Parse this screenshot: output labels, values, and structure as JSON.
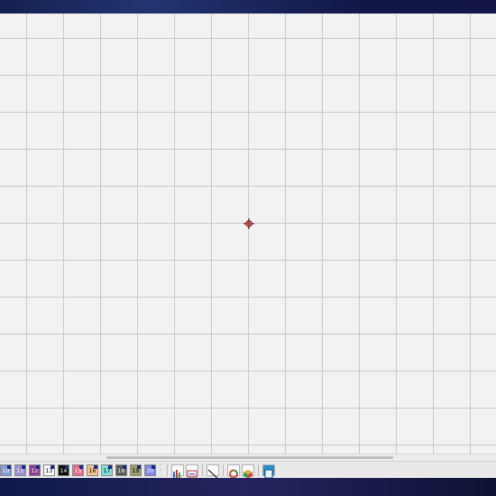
{
  "desktop": {
    "wallpaper_colors": [
      "#0d1640",
      "#1a1550",
      "#0a0f2c"
    ]
  },
  "canvas": {
    "background": "#f2f2f2",
    "grid_color": "#c9c9c9",
    "marker_color": "#8b1a1a"
  },
  "palette": [
    {
      "num": "10",
      "color": "#7f9bd6",
      "text": "#ffffff"
    },
    {
      "num": "11",
      "color": "#9d8fcf",
      "text": "#ffffff"
    },
    {
      "num": "12",
      "color": "#8a3e8f",
      "text": "#ffffff"
    },
    {
      "num": "13",
      "color": "#f7f7f7",
      "text": "#000000"
    },
    {
      "num": "14",
      "color": "#111111",
      "text": "#ffffff"
    },
    {
      "num": "15",
      "color": "#e76a8a",
      "text": "#ffffff"
    },
    {
      "num": "16",
      "color": "#f3c48a",
      "text": "#000000"
    },
    {
      "num": "17",
      "color": "#7fe0d6",
      "text": "#000000"
    },
    {
      "num": "18",
      "color": "#5a5a5a",
      "text": "#ffffff"
    },
    {
      "num": "19",
      "color": "#9b9b6a",
      "text": "#000000"
    },
    {
      "num": "20",
      "color": "#7f87e6",
      "text": "#ffffff"
    }
  ],
  "spinner": {
    "up": "˄",
    "down": "˅"
  },
  "tools": [
    {
      "name": "bars-tool-icon"
    },
    {
      "name": "text-tool-icon"
    },
    {
      "name": "line-tool-icon"
    },
    {
      "name": "ring-tool-icon"
    },
    {
      "name": "cube-tool-icon"
    },
    {
      "name": "frame-tool-icon"
    }
  ]
}
